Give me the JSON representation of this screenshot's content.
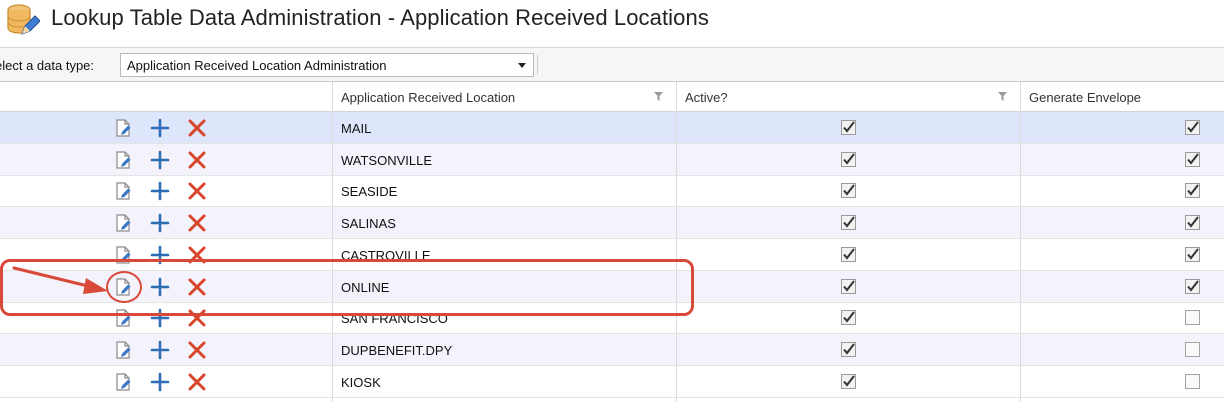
{
  "header": {
    "title": "Lookup Table Data Administration - Application Received Locations",
    "icon": "database-edit-icon"
  },
  "toolbar": {
    "label": "elect a data type:",
    "select_value": "Application Received Location Administration"
  },
  "grid": {
    "columns": [
      {
        "label": ""
      },
      {
        "label": "Application Received Location"
      },
      {
        "label": "Active?"
      },
      {
        "label": "Generate Envelope"
      }
    ],
    "row_actions": [
      "edit-icon",
      "add-icon",
      "delete-icon"
    ],
    "rows": [
      {
        "location": "MAIL",
        "active": true,
        "generate_envelope": true
      },
      {
        "location": "WATSONVILLE",
        "active": true,
        "generate_envelope": true
      },
      {
        "location": "SEASIDE",
        "active": true,
        "generate_envelope": true
      },
      {
        "location": "SALINAS",
        "active": true,
        "generate_envelope": true
      },
      {
        "location": "CASTROVILLE",
        "active": true,
        "generate_envelope": true
      },
      {
        "location": "ONLINE",
        "active": true,
        "generate_envelope": true
      },
      {
        "location": "SAN FRANCISCO",
        "active": true,
        "generate_envelope": false
      },
      {
        "location": "DUPBENEFIT.DPY",
        "active": true,
        "generate_envelope": false
      },
      {
        "location": "KIOSK",
        "active": true,
        "generate_envelope": false
      }
    ],
    "selected_row": 0
  },
  "colors": {
    "annotation": "#d9493a",
    "selected_row": "#dde6fa",
    "alt_row": "#f4f2fb",
    "add_icon": "#2f6db5",
    "delete_icon": "#d9452b"
  }
}
